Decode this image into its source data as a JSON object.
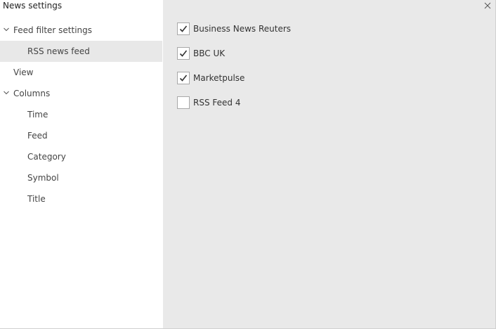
{
  "window": {
    "title": "News settings"
  },
  "sidebar": {
    "items": [
      {
        "label": "Feed filter settings",
        "level": 0,
        "expanded": true
      },
      {
        "label": "RSS news feed",
        "level": 1,
        "selected": true
      },
      {
        "label": "View",
        "level": 0
      },
      {
        "label": "Columns",
        "level": 0,
        "expanded": true
      },
      {
        "label": "Time",
        "level": 1
      },
      {
        "label": "Feed",
        "level": 1
      },
      {
        "label": "Category",
        "level": 1
      },
      {
        "label": "Symbol",
        "level": 1
      },
      {
        "label": "Title",
        "level": 1
      }
    ]
  },
  "feeds": [
    {
      "label": "Business News Reuters",
      "checked": true
    },
    {
      "label": "BBC UK",
      "checked": true
    },
    {
      "label": "Marketpulse",
      "checked": true
    },
    {
      "label": "RSS Feed 4",
      "checked": false
    }
  ],
  "colors": {
    "content_background": "#e9e9e9",
    "selected_item_background": "#e8e8e8",
    "checkbox_border": "#a8a8a8",
    "text": "#333333"
  },
  "icons": {
    "close": "close-icon",
    "expand": "chevron-down-icon",
    "check": "checkmark-icon"
  }
}
